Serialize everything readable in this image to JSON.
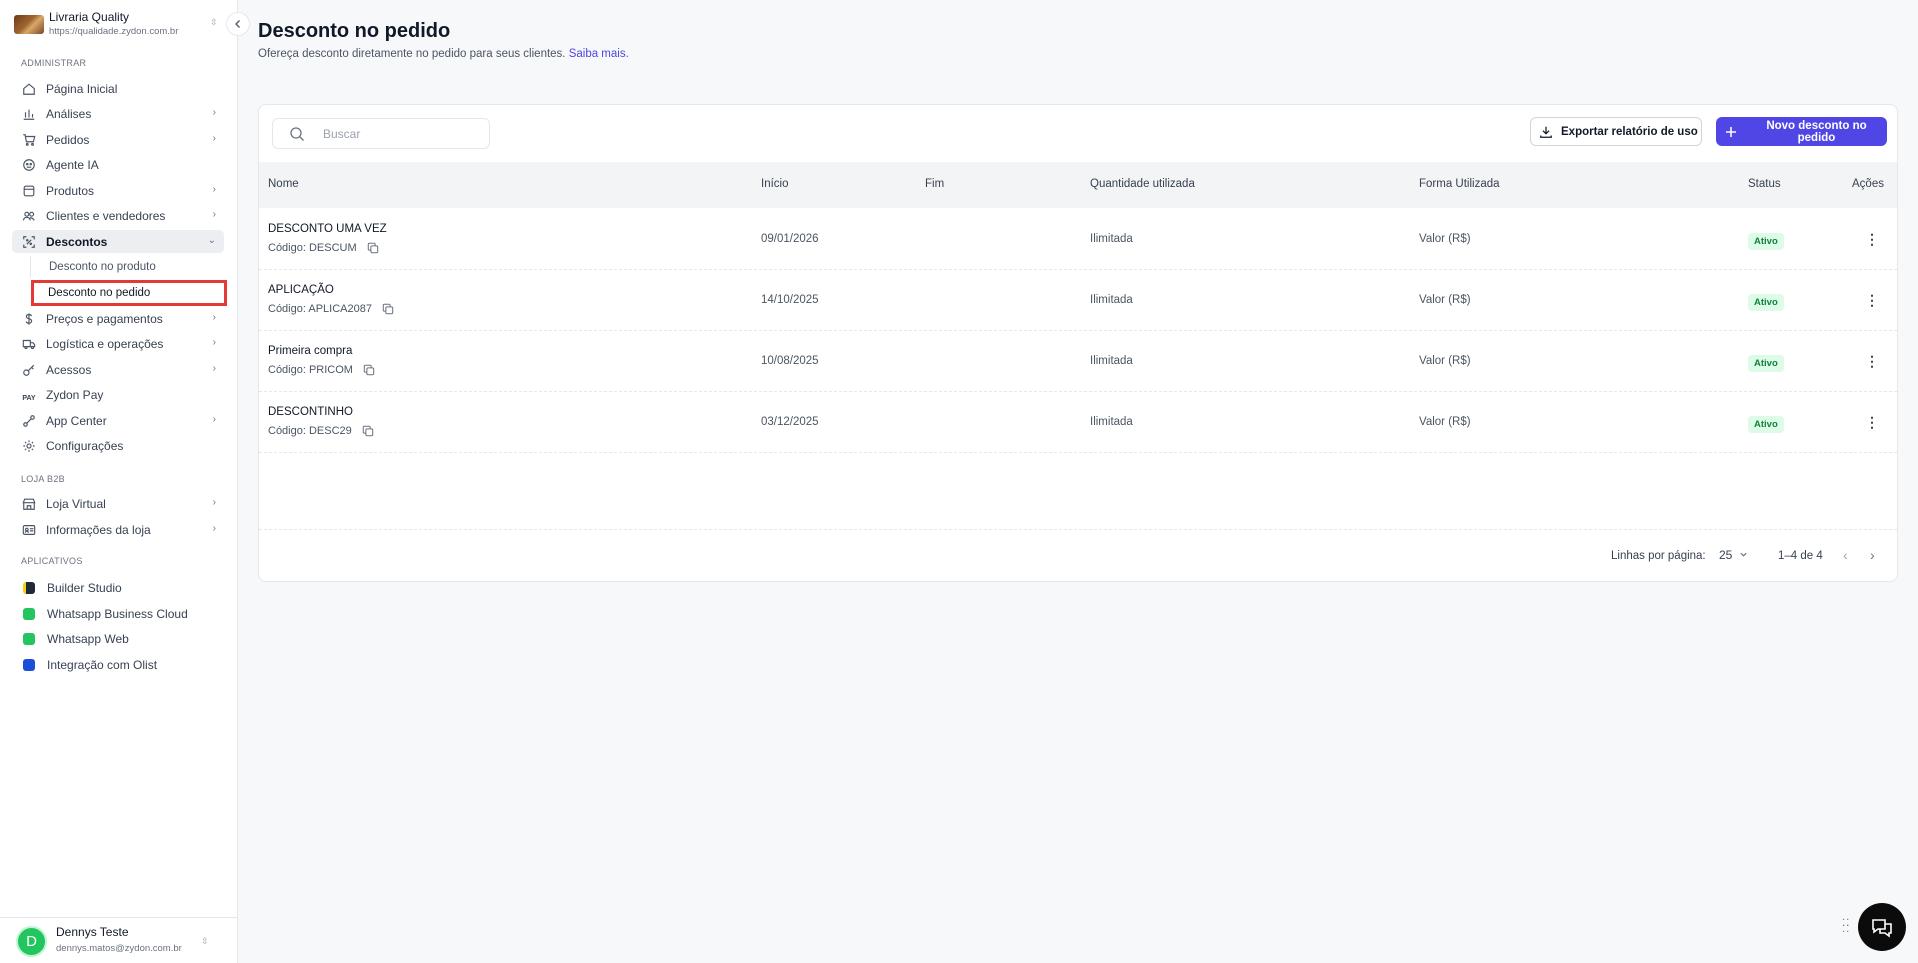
{
  "store": {
    "name": "Livraria Quality",
    "url": "https://qualidade.zydon.com.br",
    "toggle_glyph": "⇳"
  },
  "sidebar": {
    "section_admin": "ADMINISTRAR",
    "items": [
      {
        "label": "Página Inicial",
        "icon": "home-icon"
      },
      {
        "label": "Análises",
        "icon": "chart-icon",
        "chevron": "›"
      },
      {
        "label": "Pedidos",
        "icon": "cart-icon",
        "chevron": "›"
      },
      {
        "label": "Agente IA",
        "icon": "robot-icon"
      },
      {
        "label": "Produtos",
        "icon": "box-icon",
        "chevron": "›"
      },
      {
        "label": "Clientes e vendedores",
        "icon": "users-icon",
        "chevron": "›"
      },
      {
        "label": "Descontos",
        "icon": "discount-icon",
        "chevron": "⌄"
      },
      {
        "label": "Preços e pagamentos",
        "icon": "dollar-icon",
        "chevron": "›"
      },
      {
        "label": "Logística e operações",
        "icon": "truck-icon",
        "chevron": "›"
      },
      {
        "label": "Acessos",
        "icon": "key-icon",
        "chevron": "›"
      },
      {
        "label": "Zydon Pay",
        "icon": "pay-icon",
        "icon_text": "PAY"
      },
      {
        "label": "App Center",
        "icon": "link-icon",
        "chevron": "›"
      },
      {
        "label": "Configurações",
        "icon": "gear-icon"
      }
    ],
    "sub_items": [
      {
        "label": "Desconto no produto"
      },
      {
        "label": "Desconto no pedido"
      }
    ],
    "section_b2b": "LOJA B2B",
    "b2b_items": [
      {
        "label": "Loja Virtual",
        "icon": "store-icon",
        "chevron": "›"
      },
      {
        "label": "Informações da loja",
        "icon": "id-card-icon",
        "chevron": "›"
      }
    ],
    "section_apps": "APLICATIVOS",
    "apps": [
      {
        "label": "Builder Studio",
        "color": "#1f2937",
        "accent": "#facc15"
      },
      {
        "label": "Whatsapp Business Cloud",
        "color": "#22c55e"
      },
      {
        "label": "Whatsapp Web",
        "color": "#22c55e"
      },
      {
        "label": "Integração com Olist",
        "color": "#1d4ed8"
      }
    ]
  },
  "user": {
    "initial": "D",
    "name": "Dennys Teste",
    "email": "dennys.matos@zydon.com.br",
    "toggle_glyph": "⇳"
  },
  "page": {
    "title": "Desconto no pedido",
    "subtitle": "Ofereça desconto diretamente no pedido para seus clientes.",
    "learn_more": "Saiba mais."
  },
  "toolbar": {
    "search_placeholder": "Buscar",
    "export_label": "Exportar relatório de uso",
    "new_label": "Novo desconto no pedido"
  },
  "table": {
    "headers": {
      "name": "Nome",
      "start": "Início",
      "end": "Fim",
      "qty": "Quantidade utilizada",
      "form": "Forma Utilizada",
      "status": "Status",
      "actions": "Ações"
    },
    "rows": [
      {
        "name": "DESCONTO UMA VEZ",
        "code": "Código: DESCUM",
        "start": "09/01/2026",
        "end": "",
        "qty": "Ilimitada",
        "form": "Valor (R$)",
        "status": "Ativo"
      },
      {
        "name": "APLICAÇÃO",
        "code": "Código: APLICA2087",
        "start": "14/10/2025",
        "end": "",
        "qty": "Ilimitada",
        "form": "Valor (R$)",
        "status": "Ativo"
      },
      {
        "name": "Primeira compra",
        "code": "Código: PRICOM",
        "start": "10/08/2025",
        "end": "",
        "qty": "Ilimitada",
        "form": "Valor (R$)",
        "status": "Ativo"
      },
      {
        "name": "DESCONTINHO",
        "code": "Código: DESC29",
        "start": "03/12/2025",
        "end": "",
        "qty": "Ilimitada",
        "form": "Valor (R$)",
        "status": "Ativo"
      }
    ]
  },
  "pagination": {
    "rows_label": "Linhas por página:",
    "rows_value": "25",
    "range": "1–4 de 4"
  },
  "colors": {
    "accent": "#5046e5",
    "active_badge_bg": "#dcfce7",
    "active_badge_text": "#15803d",
    "highlight": "#e53935"
  }
}
